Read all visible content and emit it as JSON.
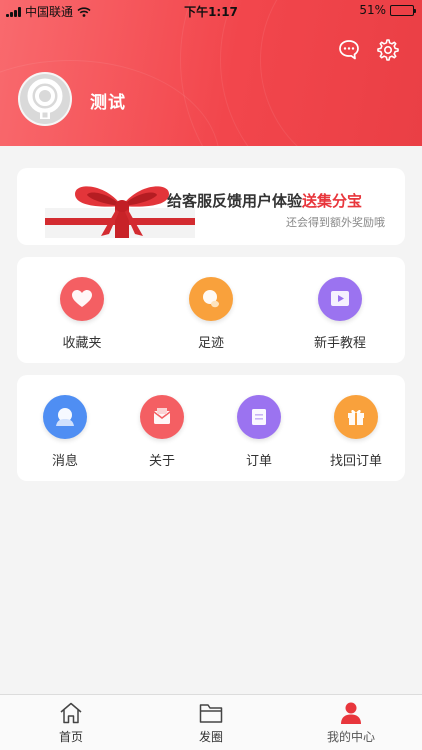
{
  "status_bar": {
    "carrier": "中国联通",
    "time": "下午1:17",
    "battery": "51%",
    "battery_level": 0.51
  },
  "header": {
    "username": "测试",
    "icons": [
      "chat-icon",
      "gear-icon"
    ],
    "accent": "#f2464c"
  },
  "banner": {
    "title": "给客服反馈用户体验",
    "title_highlight": "送集分宝",
    "subtitle": "还会得到额外奖励哦"
  },
  "shortcuts": [
    {
      "label": "收藏夹",
      "icon": "heart-icon",
      "color": "#f45f63"
    },
    {
      "label": "足迹",
      "icon": "footprint-icon",
      "color": "#f9a13c"
    },
    {
      "label": "新手教程",
      "icon": "video-icon",
      "color": "#9b73f0"
    }
  ],
  "services": [
    {
      "label": "消息",
      "icon": "message-icon",
      "color": "#4f8ef3"
    },
    {
      "label": "关于",
      "icon": "about-icon",
      "color": "#f45f63"
    },
    {
      "label": "订单",
      "icon": "order-icon",
      "color": "#9b73f0"
    },
    {
      "label": "找回订单",
      "icon": "gift-box-icon",
      "color": "#f9a13c"
    }
  ],
  "tabbar": [
    {
      "label": "首页",
      "icon": "home-icon"
    },
    {
      "label": "发圈",
      "icon": "folder-icon"
    },
    {
      "label": "我的中心",
      "icon": "user-icon",
      "active": true,
      "active_color": "#e8363c"
    }
  ]
}
